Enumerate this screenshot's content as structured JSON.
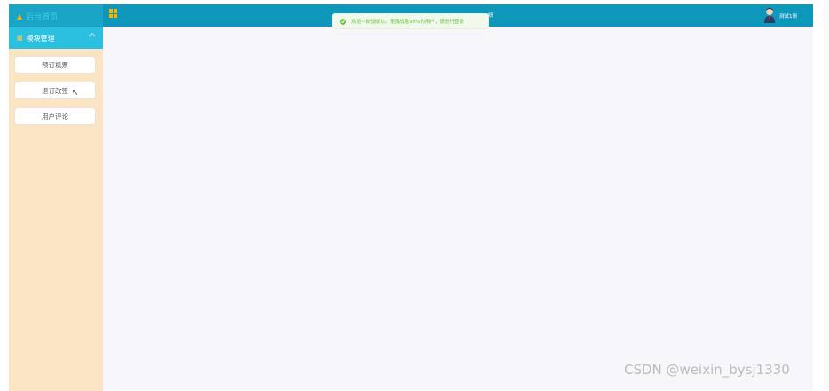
{
  "brand": {
    "title": "后台首页",
    "home_icon": "home-icon"
  },
  "sidebar": {
    "menu_title": "模块管理",
    "items": [
      {
        "label": "预订机票"
      },
      {
        "label": "退订改签"
      },
      {
        "label": "用户评论"
      }
    ]
  },
  "topbar": {
    "system_title": "统",
    "username": "测试1测"
  },
  "toast": {
    "message": "欢迎~校验成功。速度战胜99%的用户，请进行登录"
  },
  "watermark": "CSDN @weixin_bysj1330",
  "colors": {
    "sidebar_bg": "#fbe4c4",
    "brand_bg": "#1aa5c6",
    "menu_head_bg": "#2bbfe0",
    "topbar_bg": "#0d97ba",
    "accent": "#f5b400",
    "toast_text": "#67c23a"
  }
}
